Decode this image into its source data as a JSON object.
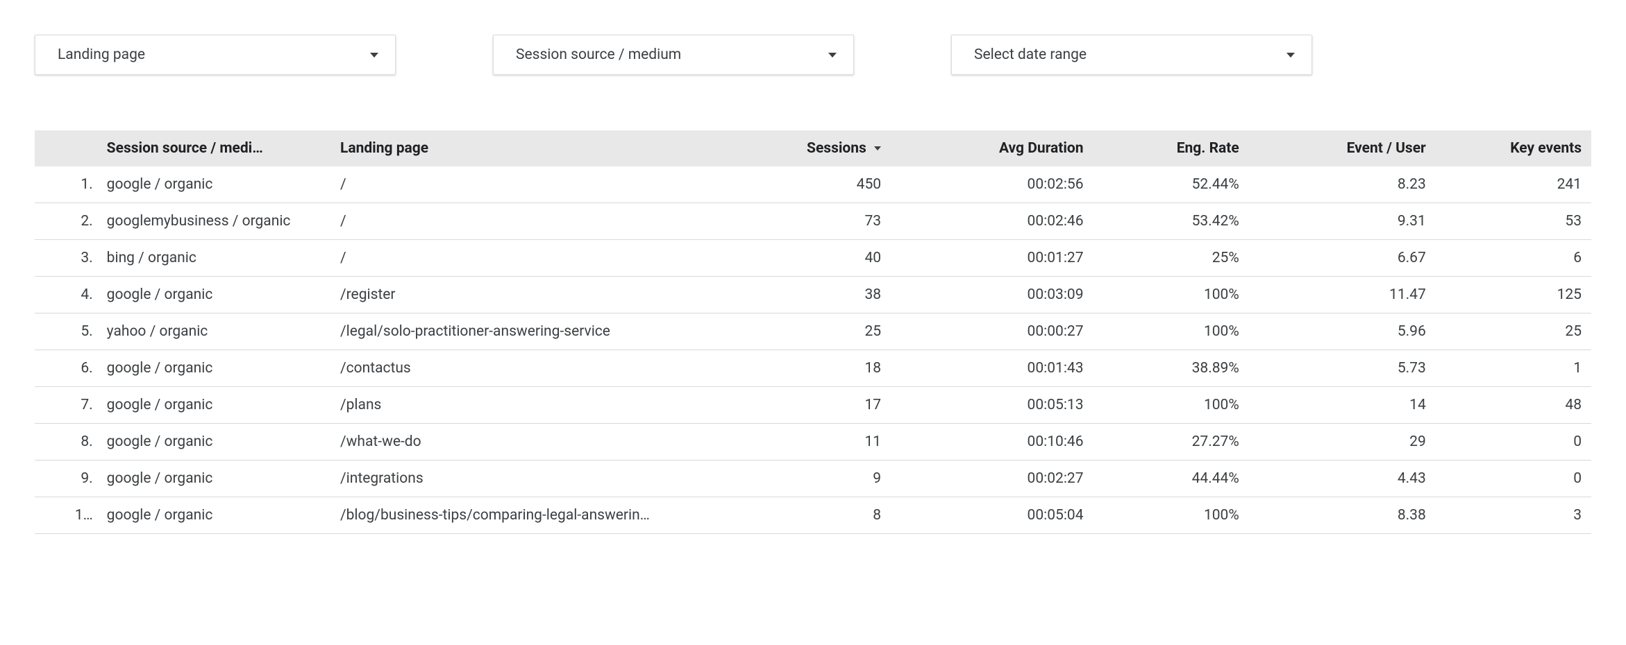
{
  "filters": {
    "landing_page": {
      "label": "Landing page"
    },
    "source_medium": {
      "label": "Session source / medium"
    },
    "date_range": {
      "label": "Select date range"
    }
  },
  "table": {
    "columns": {
      "source_medium": "Session source / medi…",
      "landing_page": "Landing page",
      "sessions": "Sessions",
      "avg_duration": "Avg Duration",
      "eng_rate": "Eng. Rate",
      "event_user": "Event / User",
      "key_events": "Key events"
    },
    "sorted_by": "sessions",
    "rows": [
      {
        "idx": "1.",
        "source": "google / organic",
        "page": "/",
        "sessions": "450",
        "duration": "00:02:56",
        "eng_rate": "52.44%",
        "event_user": "8.23",
        "key_events": "241"
      },
      {
        "idx": "2.",
        "source": "googlemybusiness / organic",
        "page": "/",
        "sessions": "73",
        "duration": "00:02:46",
        "eng_rate": "53.42%",
        "event_user": "9.31",
        "key_events": "53"
      },
      {
        "idx": "3.",
        "source": "bing / organic",
        "page": "/",
        "sessions": "40",
        "duration": "00:01:27",
        "eng_rate": "25%",
        "event_user": "6.67",
        "key_events": "6"
      },
      {
        "idx": "4.",
        "source": "google / organic",
        "page": "/register",
        "sessions": "38",
        "duration": "00:03:09",
        "eng_rate": "100%",
        "event_user": "11.47",
        "key_events": "125"
      },
      {
        "idx": "5.",
        "source": "yahoo / organic",
        "page": "/legal/solo-practitioner-answering-service",
        "sessions": "25",
        "duration": "00:00:27",
        "eng_rate": "100%",
        "event_user": "5.96",
        "key_events": "25"
      },
      {
        "idx": "6.",
        "source": "google / organic",
        "page": "/contactus",
        "sessions": "18",
        "duration": "00:01:43",
        "eng_rate": "38.89%",
        "event_user": "5.73",
        "key_events": "1"
      },
      {
        "idx": "7.",
        "source": "google / organic",
        "page": "/plans",
        "sessions": "17",
        "duration": "00:05:13",
        "eng_rate": "100%",
        "event_user": "14",
        "key_events": "48"
      },
      {
        "idx": "8.",
        "source": "google / organic",
        "page": "/what-we-do",
        "sessions": "11",
        "duration": "00:10:46",
        "eng_rate": "27.27%",
        "event_user": "29",
        "key_events": "0"
      },
      {
        "idx": "9.",
        "source": "google / organic",
        "page": "/integrations",
        "sessions": "9",
        "duration": "00:02:27",
        "eng_rate": "44.44%",
        "event_user": "4.43",
        "key_events": "0"
      },
      {
        "idx": "1…",
        "source": "google / organic",
        "page": "/blog/business-tips/comparing-legal-answerin…",
        "sessions": "8",
        "duration": "00:05:04",
        "eng_rate": "100%",
        "event_user": "8.38",
        "key_events": "3"
      }
    ]
  }
}
